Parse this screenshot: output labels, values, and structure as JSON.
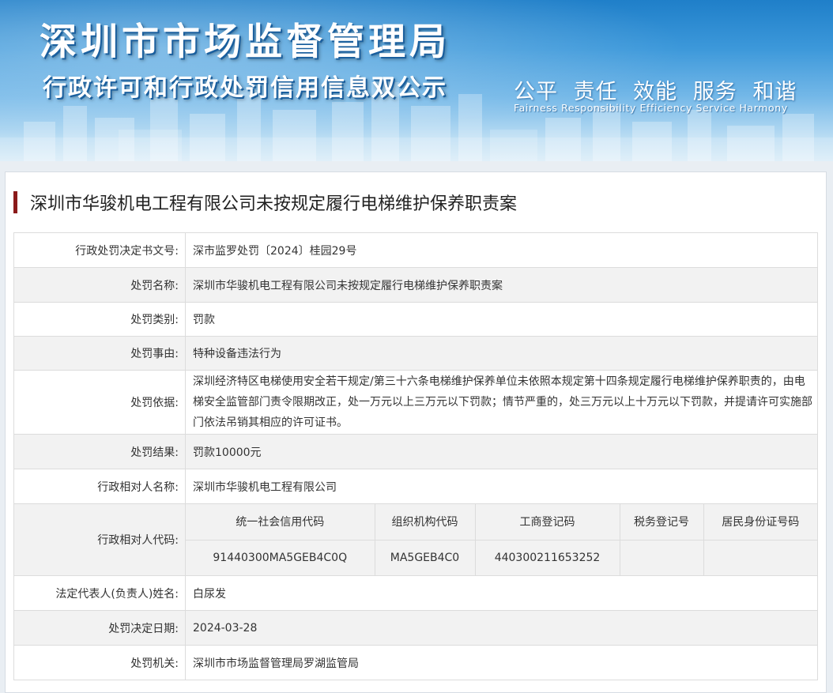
{
  "banner": {
    "title": "深圳市市场监督管理局",
    "subtitle": "行政许可和行政处罚信用信息双公示",
    "slogan": "公平 责任 效能 服务 和谐",
    "slogan_en": "Fairness Responsibility Efficiency Service Harmony"
  },
  "case": {
    "title": "深圳市华骏机电工程有限公司未按规定履行电梯维护保养职责案"
  },
  "rows": {
    "doc_no": {
      "label": "行政处罚决定书文号:",
      "value": "深市监罗处罚〔2024〕桂园29号"
    },
    "name": {
      "label": "处罚名称:",
      "value": "深圳市华骏机电工程有限公司未按规定履行电梯维护保养职责案"
    },
    "category": {
      "label": "处罚类别:",
      "value": "罚款"
    },
    "reason": {
      "label": "处罚事由:",
      "value": "特种设备违法行为"
    },
    "basis": {
      "label": "处罚依据:",
      "value": "深圳经济特区电梯使用安全若干规定/第三十六条电梯维护保养单位未依照本规定第十四条规定履行电梯维护保养职责的，由电梯安全监管部门责令限期改正，处一万元以上三万元以下罚款；情节严重的，处三万元以上十万元以下罚款，并提请许可实施部门依法吊销其相应的许可证书。"
    },
    "result": {
      "label": "处罚结果:",
      "value": "罚款10000元"
    },
    "party_name": {
      "label": "行政相对人名称:",
      "value": "深圳市华骏机电工程有限公司"
    },
    "party_code": {
      "label": "行政相对人代码:",
      "headers": [
        "统一社会信用代码",
        "组织机构代码",
        "工商登记码",
        "税务登记号",
        "居民身份证号码"
      ],
      "values": [
        "91440300MA5GEB4C0Q",
        "MA5GEB4C0",
        "440300211653252",
        "",
        ""
      ]
    },
    "legal_rep": {
      "label": "法定代表人(负责人)姓名:",
      "value": "白尿发"
    },
    "date": {
      "label": "处罚决定日期:",
      "value": "2024-03-28"
    },
    "authority": {
      "label": "处罚机关:",
      "value": "深圳市市场监督管理局罗湖监管局"
    }
  }
}
